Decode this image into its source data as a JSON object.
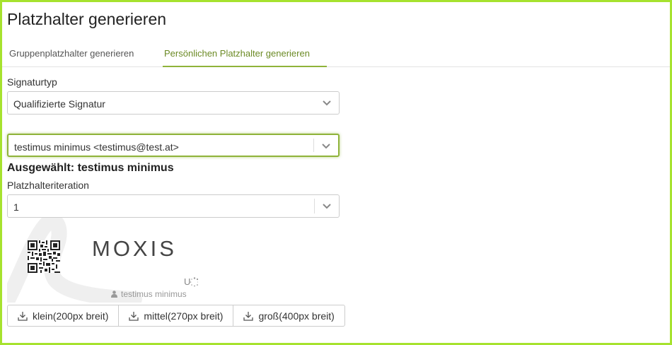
{
  "page": {
    "title": "Platzhalter generieren"
  },
  "tabs": [
    {
      "label": "Gruppenplatzhalter generieren",
      "active": false
    },
    {
      "label": "Persönlichen Platzhalter generieren",
      "active": true
    }
  ],
  "signature_type": {
    "label": "Signaturtyp",
    "value": "Qualifizierte Signatur",
    "icon": "chevron-down-icon"
  },
  "user_select": {
    "value": "testimus minimus <testimus@test.at>",
    "icon": "chevron-down-icon"
  },
  "selected": {
    "text": "Ausgewählt: testimus minimus"
  },
  "iteration": {
    "label": "Platzhalteriteration",
    "value": "1",
    "icon": "chevron-down-icon"
  },
  "preview": {
    "logo_text": "MOXIS",
    "status_letter": "U",
    "signer_name": "testimus minimus",
    "icons": [
      "qr-code-icon",
      "spinner-icon",
      "person-icon",
      "signature-watermark"
    ]
  },
  "downloads": [
    {
      "label": "klein(200px breit)",
      "icon": "download-icon"
    },
    {
      "label": "mittel(270px breit)",
      "icon": "download-icon"
    },
    {
      "label": "groß(400px breit)",
      "icon": "download-icon"
    }
  ],
  "colors": {
    "accent": "#8fb33a",
    "frame": "#a6e22e",
    "tab_active": "#6b8a24"
  }
}
